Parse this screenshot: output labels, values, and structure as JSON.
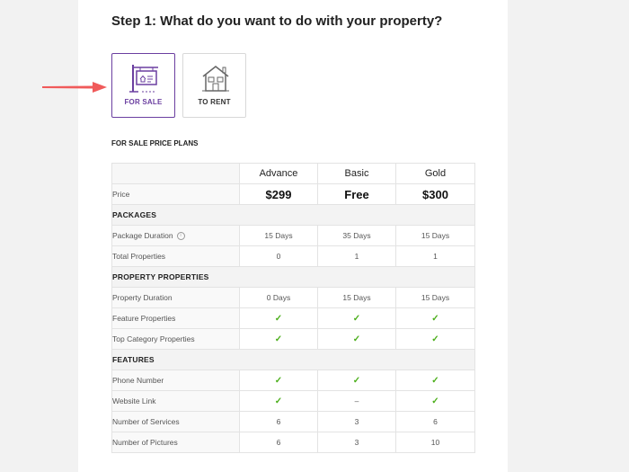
{
  "page": {
    "title": "Step 1: What do you want to do with your property?",
    "options": [
      {
        "label": "FOR SALE",
        "icon": "for-sale-sign-icon",
        "selected": true
      },
      {
        "label": "TO RENT",
        "icon": "house-icon",
        "selected": false
      }
    ],
    "plans_heading": "FOR SALE PRICE PLANS",
    "colors": {
      "accent": "#6b3fa0",
      "arrow": "#f05a5a",
      "check": "#4caf1b"
    }
  },
  "plans": {
    "columns": [
      "Advance",
      "Basic",
      "Gold"
    ],
    "price_label": "Price",
    "prices": [
      "$299",
      "Free",
      "$300"
    ],
    "sections": [
      {
        "title": "PACKAGES",
        "rows": [
          {
            "label": "Package Duration",
            "info": "i",
            "values": [
              "15 Days",
              "35 Days",
              "15 Days"
            ]
          },
          {
            "label": "Total Properties",
            "values": [
              "0",
              "1",
              "1"
            ]
          }
        ]
      },
      {
        "title": "PROPERTY PROPERTIES",
        "rows": [
          {
            "label": "Property Duration",
            "values": [
              "0 Days",
              "15 Days",
              "15 Days"
            ]
          },
          {
            "label": "Feature Properties",
            "values": [
              "✓",
              "✓",
              "✓"
            ]
          },
          {
            "label": "Top Category Properties",
            "values": [
              "✓",
              "✓",
              "✓"
            ]
          }
        ]
      },
      {
        "title": "FEATURES",
        "rows": [
          {
            "label": "Phone Number",
            "values": [
              "✓",
              "✓",
              "✓"
            ]
          },
          {
            "label": "Website Link",
            "values": [
              "✓",
              "–",
              "✓"
            ]
          },
          {
            "label": "Number of Services",
            "values": [
              "6",
              "3",
              "6"
            ]
          },
          {
            "label": "Number of Pictures",
            "values": [
              "6",
              "3",
              "10"
            ]
          }
        ]
      }
    ]
  }
}
